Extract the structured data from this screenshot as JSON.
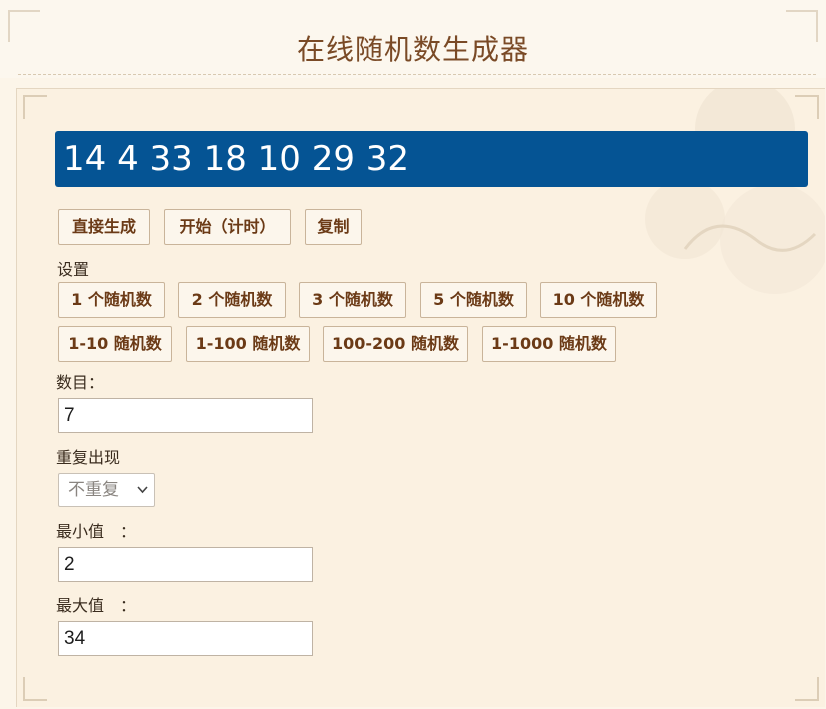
{
  "header": {
    "title": "在线随机数生成器"
  },
  "result": {
    "numbers": "14 4 33 18 10 29 32"
  },
  "actions": {
    "generate": "直接生成",
    "start_timer": "开始（计时）",
    "copy": "复制"
  },
  "settings": {
    "label": "设置",
    "count_presets": [
      "1 个随机数",
      "2 个随机数",
      "3 个随机数",
      "5 个随机数",
      "10 个随机数"
    ],
    "range_presets": [
      "1-10 随机数",
      "1-100 随机数",
      "100-200 随机数",
      "1-1000 随机数"
    ]
  },
  "form": {
    "count_label": "数目：",
    "count_value": "7",
    "repeat_label": "重复出现",
    "repeat_selected": "不重复",
    "min_label": "最小值　：",
    "min_value": "2",
    "max_label": "最大值　：",
    "max_value": "34"
  },
  "colors": {
    "result_bg": "#055494",
    "title": "#7a4a26",
    "button_text": "#6b3a16"
  }
}
